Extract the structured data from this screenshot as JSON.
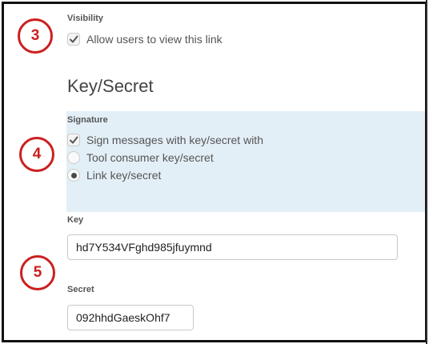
{
  "visibility": {
    "label": "Visibility",
    "checkbox_label": "Allow users to view this link",
    "checked": true
  },
  "key_secret": {
    "heading": "Key/Secret"
  },
  "signature": {
    "label": "Signature",
    "sign_label": "Sign messages with key/secret with",
    "sign_checked": true,
    "options": [
      {
        "label": "Tool consumer key/secret",
        "selected": false
      },
      {
        "label": "Link key/secret",
        "selected": true
      }
    ]
  },
  "key": {
    "label": "Key",
    "value": "hd7Y534VFghd985jfuymnd"
  },
  "secret": {
    "label": "Secret",
    "value": "092hhdGaeskOhf7"
  },
  "annotations": {
    "step3": "3",
    "step4": "4",
    "step5": "5"
  },
  "colors": {
    "annotation_red": "#cc1f1f",
    "panel_blue": "#e3eff7"
  }
}
